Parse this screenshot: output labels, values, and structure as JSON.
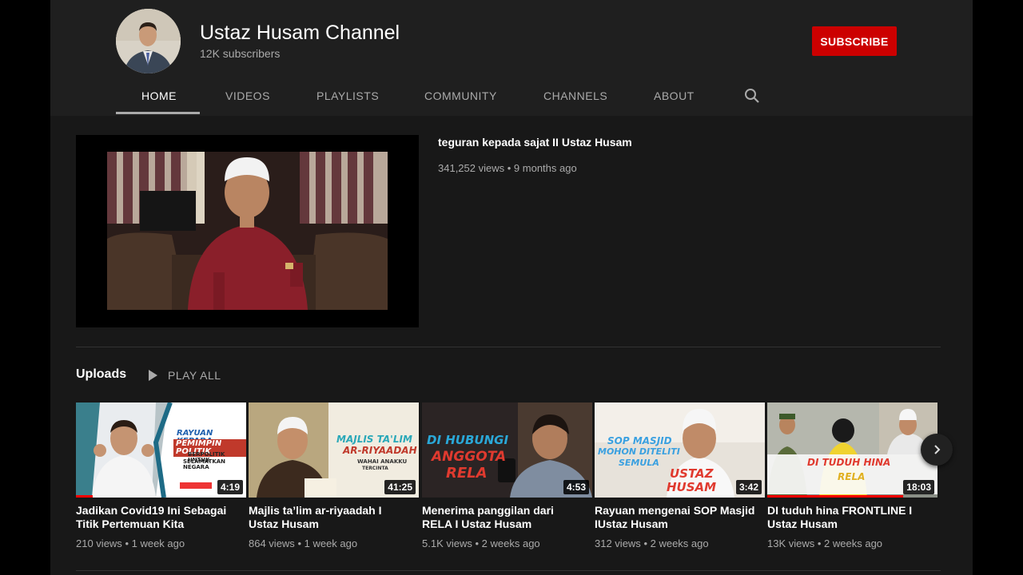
{
  "channel": {
    "name": "Ustaz Husam Channel",
    "subscribers": "12K subscribers",
    "subscribe_label": "SUBSCRIBE"
  },
  "tabs": [
    {
      "label": "HOME",
      "active": true
    },
    {
      "label": "VIDEOS"
    },
    {
      "label": "PLAYLISTS"
    },
    {
      "label": "COMMUNITY"
    },
    {
      "label": "CHANNELS"
    },
    {
      "label": "ABOUT"
    }
  ],
  "featured": {
    "title": "teguran kepada sajat II Ustaz Husam",
    "views": "341,252 views",
    "age": "9 months ago"
  },
  "uploads": {
    "title": "Uploads",
    "play_all": "PLAY ALL",
    "videos": [
      {
        "title": "Jadikan Covid19 Ini Sebagai Titik Pertemuan Kita",
        "duration": "4:19",
        "views": "210 views",
        "age": "1 week ago",
        "watched": 0.1,
        "thumb_text": [
          "RAYUAN KEPADA",
          "PEMIMPIN POLITIK",
          "BERPOLITIK UNTUK",
          "SELAMATKAN NEGARA"
        ]
      },
      {
        "title": "Majlis ta’lim ar-riyaadah I Ustaz Husam",
        "duration": "41:25",
        "views": "864 views",
        "age": "1 week ago",
        "watched": 0,
        "thumb_text": [
          "MAJLIS TA'LIM",
          "AR-RIYAADAH",
          "WAHAI ANAKKU",
          "TERCINTA"
        ]
      },
      {
        "title": "Menerima panggilan dari RELA I Ustaz Husam",
        "duration": "4:53",
        "views": "5.1K views",
        "age": "2 weeks ago",
        "watched": 0,
        "thumb_text": [
          "DI HUBUNGI",
          "ANGGOTA",
          "RELA"
        ]
      },
      {
        "title": "Rayuan mengenai SOP Masjid IUstaz Husam",
        "duration": "3:42",
        "views": "312 views",
        "age": "2 weeks ago",
        "watched": 0,
        "thumb_text": [
          "SOP MASJID",
          "MOHON DITELITI",
          "SEMULA",
          "USTAZ",
          "HUSAM"
        ]
      },
      {
        "title": "DI tuduh hina FRONTLINE I Ustaz Husam",
        "duration": "18:03",
        "views": "13K views",
        "age": "2 weeks ago",
        "watched": 0.8,
        "thumb_text": [
          "DI TUDUH HINA",
          "RELA"
        ]
      }
    ]
  },
  "icons": {
    "search": "search-icon",
    "play": "play-icon",
    "next": "chevron-right-icon"
  },
  "colors": {
    "subscribe": "#cc0000",
    "progress": "#ff0000",
    "header_bg": "#1f1f1f",
    "content_bg": "#181818"
  }
}
